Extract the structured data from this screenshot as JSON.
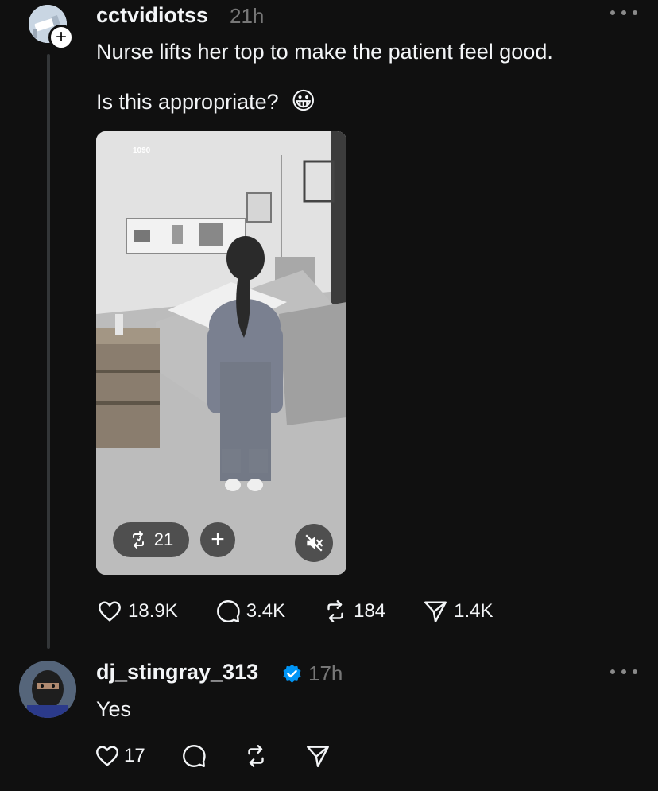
{
  "post": {
    "username": "cctvidiotss",
    "time": "21h",
    "text_line1": "Nurse lifts her top to make the patient feel good.",
    "text_line2": "Is this appropriate?",
    "emoji": "😀",
    "video": {
      "overlay_label": "1090",
      "repost_count": "21",
      "icons": [
        "repost-icon",
        "plus-icon",
        "mute-icon"
      ]
    },
    "stats": {
      "likes": "18.9K",
      "comments": "3.4K",
      "reposts": "184",
      "shares": "1.4K"
    }
  },
  "reply": {
    "username": "dj_stingray_313",
    "verified": true,
    "time": "17h",
    "text": "Yes",
    "stats": {
      "likes": "17"
    }
  },
  "colors": {
    "background": "#101010",
    "text": "#f3f5f7",
    "muted": "#777777",
    "verified": "#0095f6"
  }
}
